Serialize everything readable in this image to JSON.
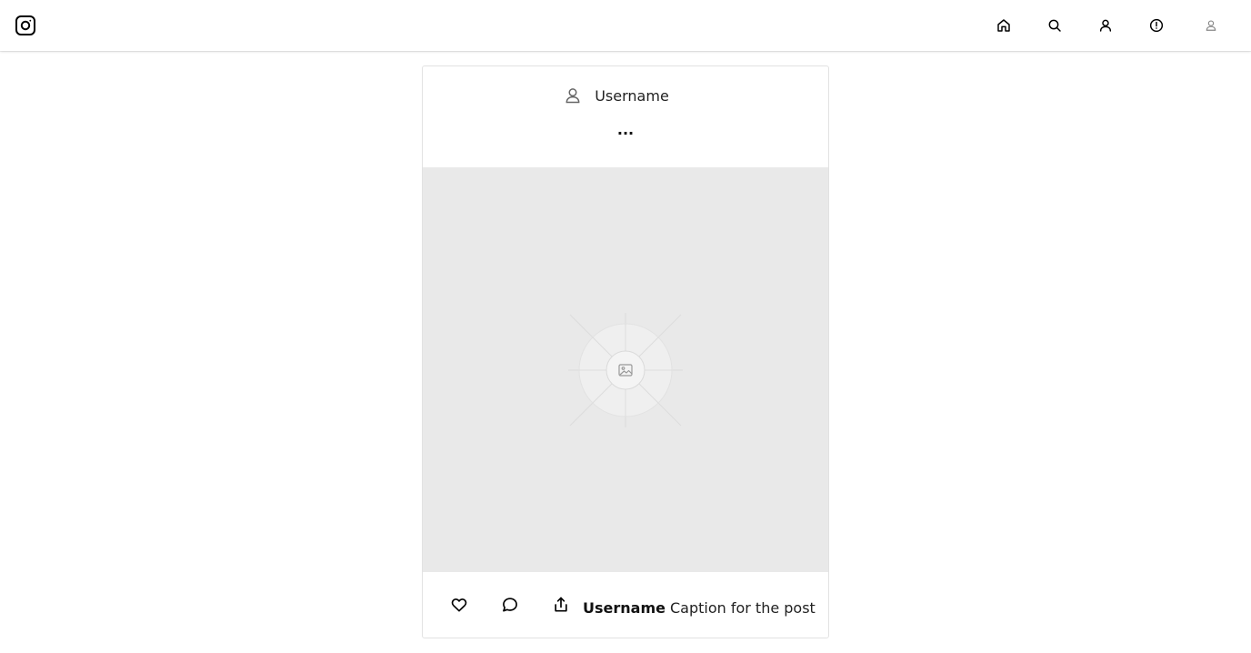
{
  "header": {
    "icons": {
      "logo": "instagram-logo-icon",
      "home": "home-icon",
      "search": "search-icon",
      "profile": "user-icon",
      "alerts": "alert-circle-icon",
      "avatar": "avatar-icon"
    }
  },
  "post": {
    "username": "Username",
    "more_label": "...",
    "caption_user": "Username",
    "caption_text": "Caption for the post",
    "image_placeholder_icon": "image-icon",
    "actions": {
      "like": "heart-icon",
      "comment": "comment-icon",
      "share": "share-icon"
    }
  }
}
